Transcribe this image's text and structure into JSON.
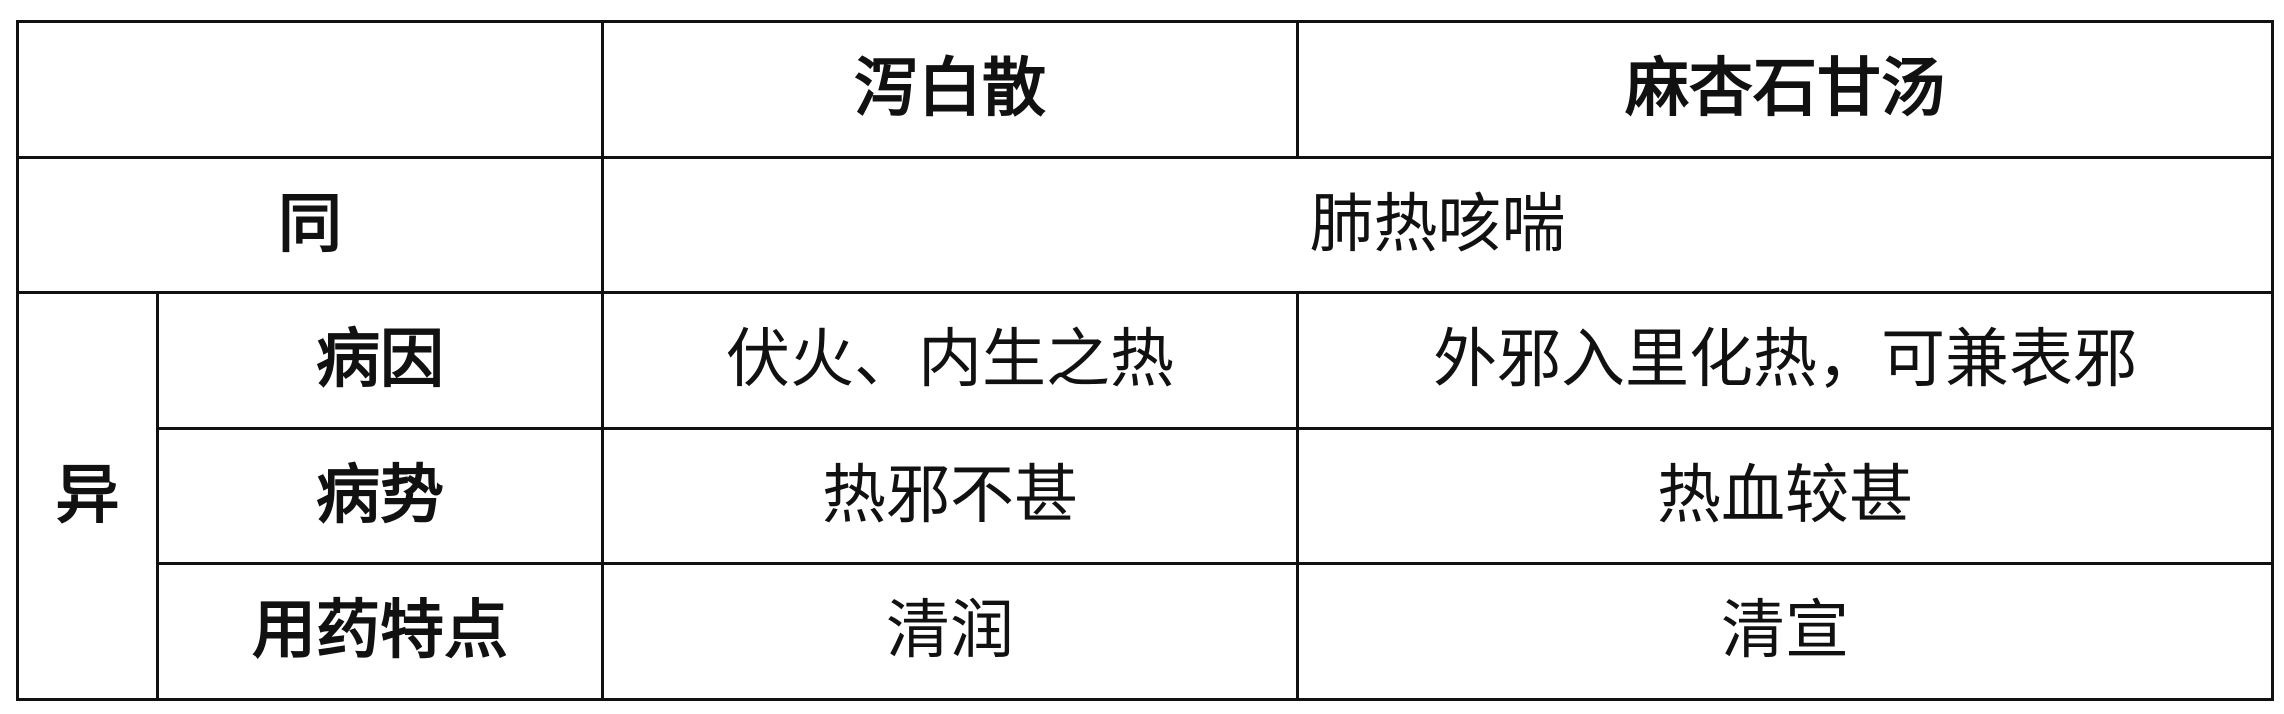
{
  "header": {
    "corner": "",
    "col1": "泻白散",
    "col2": "麻杏石甘汤"
  },
  "same_row": {
    "label": "同",
    "value": "肺热咳喘"
  },
  "diff_group": {
    "label": "异",
    "rows": [
      {
        "label": "病因",
        "col1": "伏火、内生之热",
        "col2": "外邪入里化热，可兼表邪"
      },
      {
        "label": "病势",
        "col1": "热邪不甚",
        "col2": "热血较甚"
      },
      {
        "label": "用药特点",
        "col1": "清润",
        "col2": "清宣"
      }
    ]
  }
}
